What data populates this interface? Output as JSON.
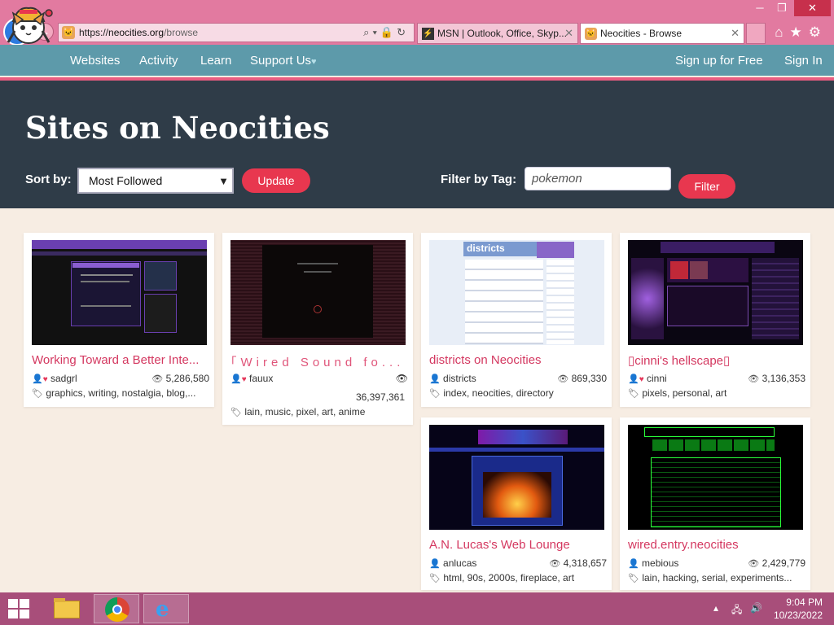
{
  "browser": {
    "url_prefix": "https://",
    "url_host": "neocities.org",
    "url_path": "/browse",
    "tabs": [
      {
        "title": "MSN | Outlook, Office, Skyp..."
      },
      {
        "title": "Neocities - Browse"
      }
    ]
  },
  "site_nav": {
    "links": [
      "Websites",
      "Activity",
      "Learn",
      "Support Us"
    ],
    "signup": "Sign up for Free",
    "signin": "Sign In"
  },
  "hero": {
    "title": "Sites on Neocities",
    "sort_label": "Sort by:",
    "sort_value": "Most Followed",
    "update_label": "Update",
    "filter_label": "Filter by Tag:",
    "filter_value": "pokemon",
    "filter_button": "Filter"
  },
  "cards": [
    {
      "title": "Working Toward a Better Inte...",
      "user": "sadgrl",
      "views": "5,286,580",
      "tags": "graphics, writing, nostalgia, blog,..."
    },
    {
      "title": "｢Wired Sound fo...",
      "user": "fauux",
      "views": "36,397,361",
      "tags": "lain, music, pixel, art, anime"
    },
    {
      "title": "districts on Neocities",
      "user": "districts",
      "views": "869,330",
      "tags": "index, neocities, directory"
    },
    {
      "title": "▯cinni's hellscape▯",
      "user": "cinni",
      "views": "3,136,353",
      "tags": "pixels, personal, art"
    },
    {
      "title": "A.N. Lucas's Web Lounge",
      "user": "anlucas",
      "views": "4,318,657",
      "tags": "html, 90s, 2000s, fireplace, art"
    },
    {
      "title": "wired.entry.neocities",
      "user": "mebious",
      "views": "2,429,779",
      "tags": "lain, hacking, serial, experiments..."
    }
  ],
  "taskbar": {
    "time": "9:04 PM",
    "date": "10/23/2022"
  },
  "colors": {
    "chrome": "#e27aa0",
    "nav": "#5d9aaa",
    "hero": "#2f3c48",
    "accent": "#e8374f",
    "title_link": "#d43860",
    "taskbar": "#a84e7a"
  }
}
